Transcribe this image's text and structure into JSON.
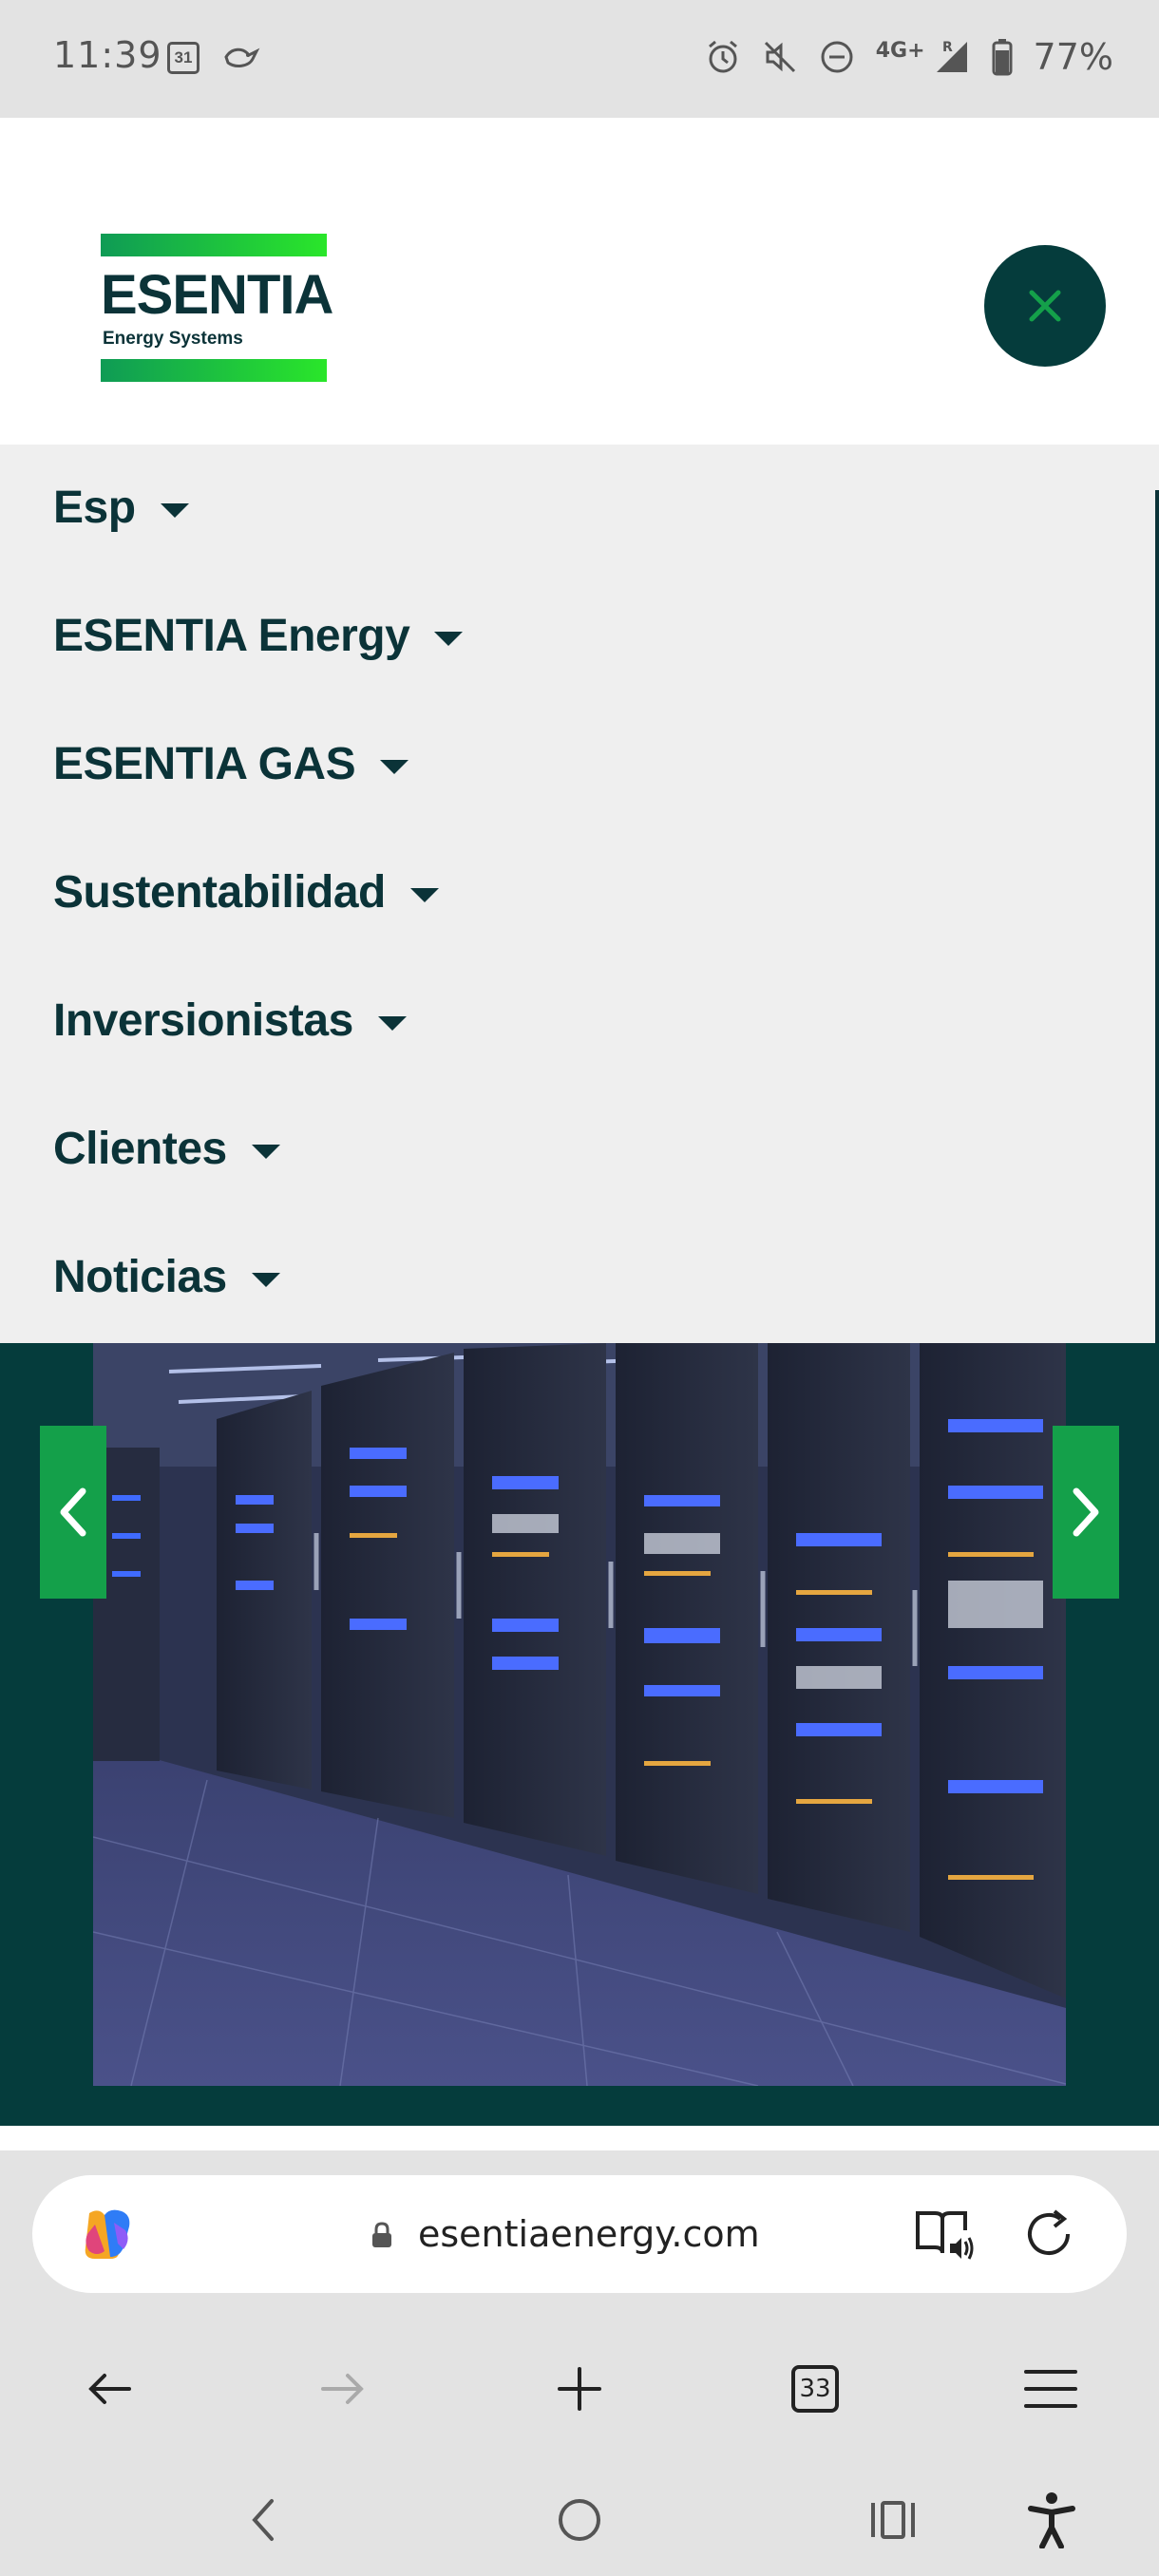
{
  "status_bar": {
    "time": "11:39",
    "calendar_day": "31",
    "network": "4G+",
    "roaming": "R",
    "battery": "77%",
    "icons": [
      "calendar-icon",
      "bird-icon",
      "alarm-icon",
      "mute-icon",
      "dnd-icon",
      "signal-icon",
      "battery-icon"
    ]
  },
  "header": {
    "logo_word": "ESENTIA",
    "logo_sub": "Energy Systems",
    "close_icon": "close-icon"
  },
  "nav": {
    "items": [
      {
        "label": "Esp"
      },
      {
        "label": "ESENTIA Energy"
      },
      {
        "label": "ESENTIA GAS"
      },
      {
        "label": "Sustentabilidad"
      },
      {
        "label": "Inversionistas"
      },
      {
        "label": "Clientes"
      },
      {
        "label": "Noticias"
      }
    ]
  },
  "hero": {
    "prev_icon": "chevron-left-icon",
    "next_icon": "chevron-right-icon"
  },
  "browser": {
    "url": "esentiaenergy.com",
    "tabs_count": "33"
  },
  "colors": {
    "brand_dark": "#053c3c",
    "brand_green": "#14a04a",
    "text_dark": "#0b3338",
    "menu_bg": "#efefef"
  }
}
